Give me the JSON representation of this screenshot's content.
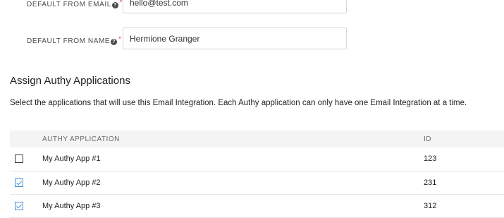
{
  "form": {
    "from_email": {
      "label": "DEFAULT FROM EMAIL",
      "value": "hello@test.com",
      "required_mark": "*",
      "help_glyph": "?"
    },
    "from_name": {
      "label": "DEFAULT FROM NAME",
      "value": "Hermione Granger",
      "required_mark": "*",
      "help_glyph": "?"
    }
  },
  "assign": {
    "title": "Assign Authy Applications",
    "description": "Select the applications that will use this Email Integration. Each Authy application can only have one Email Integration at a time."
  },
  "table": {
    "headers": {
      "application": "AUTHY APPLICATION",
      "id": "ID"
    },
    "rows": [
      {
        "name": "My Authy App #1",
        "id": "123",
        "checked": false
      },
      {
        "name": "My Authy App #2",
        "id": "231",
        "checked": true
      },
      {
        "name": "My Authy App #3",
        "id": "312",
        "checked": true
      }
    ]
  },
  "colors": {
    "accent": "#3d8ed6",
    "required": "#e0262d",
    "header_bg": "#f4f4f4"
  },
  "icons": {
    "help": "question-circle-icon",
    "check": "checkmark-icon"
  }
}
